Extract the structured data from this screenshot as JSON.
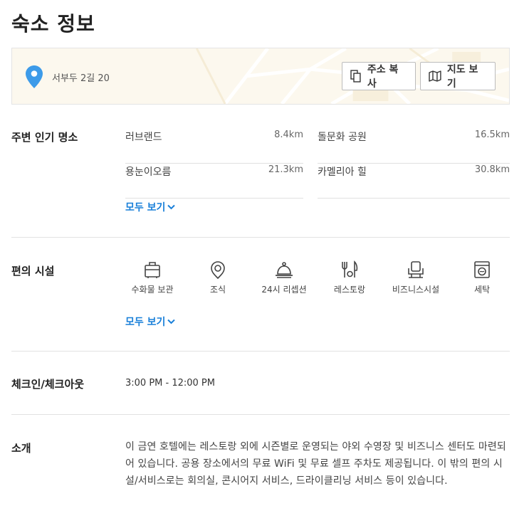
{
  "page": {
    "title": "숙소 정보"
  },
  "address": {
    "text": "서부두 2길 20",
    "copy_label": "주소 복사",
    "map_label": "지도 보기",
    "pin_icon": "location-pin-icon",
    "copy_icon": "copy-icon",
    "map_icon": "map-icon",
    "pin_color": "#3d9be9"
  },
  "nearby": {
    "label": "주변 인기 명소",
    "places": [
      {
        "name": "러브랜드",
        "distance": "8.4km"
      },
      {
        "name": "돌문화 공원",
        "distance": "16.5km"
      },
      {
        "name": "용눈이오름",
        "distance": "21.3km"
      },
      {
        "name": "카멜리아 힐",
        "distance": "30.8km"
      }
    ],
    "view_all": "모두 보기"
  },
  "amenities": {
    "label": "편의 시설",
    "items": [
      {
        "label": "수화물 보관",
        "icon": "luggage-icon"
      },
      {
        "label": "조식",
        "icon": "breakfast-icon"
      },
      {
        "label": "24시 리셉션",
        "icon": "reception-bell-icon"
      },
      {
        "label": "레스토랑",
        "icon": "restaurant-icon"
      },
      {
        "label": "비즈니스시설",
        "icon": "business-chair-icon"
      },
      {
        "label": "세탁",
        "icon": "laundry-icon"
      }
    ],
    "view_all": "모두 보기"
  },
  "checkin": {
    "label": "체크인/체크아웃",
    "value": "3:00 PM - 12:00 PM"
  },
  "intro": {
    "label": "소개",
    "text": "이 금연 호텔에는 레스토랑 외에 시즌별로 운영되는 야외 수영장 및 비즈니스 센터도 마련되어 있습니다. 공용 장소에서의 무료 WiFi 및 무료 셀프 주차도 제공됩니다. 이 밖의 편의 시설/서비스로는 회의실, 콘시어지 서비스, 드라이클리닝 서비스 등이 있습니다."
  },
  "colors": {
    "accent": "#1a80d9",
    "map_bg": "#fdfaf2"
  }
}
